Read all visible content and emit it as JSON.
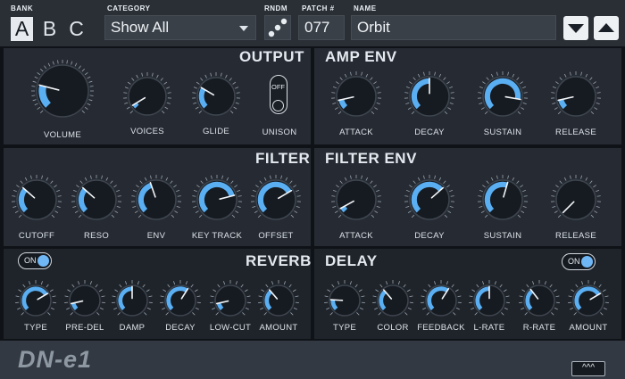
{
  "header": {
    "bank_label": "BANK",
    "banks": [
      "A",
      "B",
      "C"
    ],
    "category_label": "CATEGORY",
    "category_value": "Show All",
    "rndm_label": "RNDM",
    "patch_label": "PATCH #",
    "patch_value": "077",
    "name_label": "NAME",
    "name_value": "Orbit"
  },
  "sections": {
    "output": "OUTPUT",
    "amp_env": "AMP ENV",
    "filter": "FILTER",
    "filter_env": "FILTER ENV",
    "reverb": "REVERB",
    "delay": "DELAY"
  },
  "knobs": {
    "volume": {
      "label": "VOLUME",
      "value": 0.22
    },
    "voices": {
      "label": "VOICES",
      "value": 0.05
    },
    "glide": {
      "label": "GLIDE",
      "value": 0.28
    },
    "unison": {
      "label": "UNISON",
      "toggle_text": "OFF"
    },
    "amp_attack": {
      "label": "ATTACK",
      "value": 0.12
    },
    "amp_decay": {
      "label": "DECAY",
      "value": 0.5
    },
    "amp_sustain": {
      "label": "SUSTAIN",
      "value": 0.87
    },
    "amp_release": {
      "label": "RELEASE",
      "value": 0.12
    },
    "cutoff": {
      "label": "CUTOFF",
      "value": 0.32
    },
    "reso": {
      "label": "RESO",
      "value": 0.32
    },
    "env": {
      "label": "ENV",
      "value": 0.43
    },
    "key_track": {
      "label": "KEY TRACK",
      "value": 0.78
    },
    "offset": {
      "label": "OFFSET",
      "value": 0.72
    },
    "fenv_attack": {
      "label": "ATTACK",
      "value": 0.06
    },
    "fenv_decay": {
      "label": "DECAY",
      "value": 0.68
    },
    "fenv_sustain": {
      "label": "SUSTAIN",
      "value": 0.56
    },
    "fenv_release": {
      "label": "RELEASE",
      "value": 0.0
    },
    "rev_type": {
      "label": "TYPE",
      "value": 0.72
    },
    "pre_del": {
      "label": "PRE-DEL",
      "value": 0.12
    },
    "damp": {
      "label": "DAMP",
      "value": 0.5
    },
    "rev_decay": {
      "label": "DECAY",
      "value": 0.62
    },
    "low_cut": {
      "label": "LOW-CUT",
      "value": 0.12
    },
    "amount": {
      "label": "AMOUNT",
      "value": 0.35
    },
    "dly_type": {
      "label": "TYPE",
      "value": 0.18
    },
    "color": {
      "label": "COLOR",
      "value": 0.35
    },
    "feedback": {
      "label": "FEEDBACK",
      "value": 0.62
    },
    "l_rate": {
      "label": "L-RATE",
      "value": 0.5
    },
    "r_rate": {
      "label": "R-RATE",
      "value": 0.36
    },
    "dly_amount": {
      "label": "AMOUNT",
      "value": 0.72
    }
  },
  "reverb_toggle": "ON",
  "delay_toggle": "ON",
  "footer": {
    "logo": "DN-e1",
    "expand_glyph": "^^^"
  },
  "colors": {
    "accent": "#5aaef2",
    "panel": "#262b33",
    "background": "#0f1318"
  }
}
